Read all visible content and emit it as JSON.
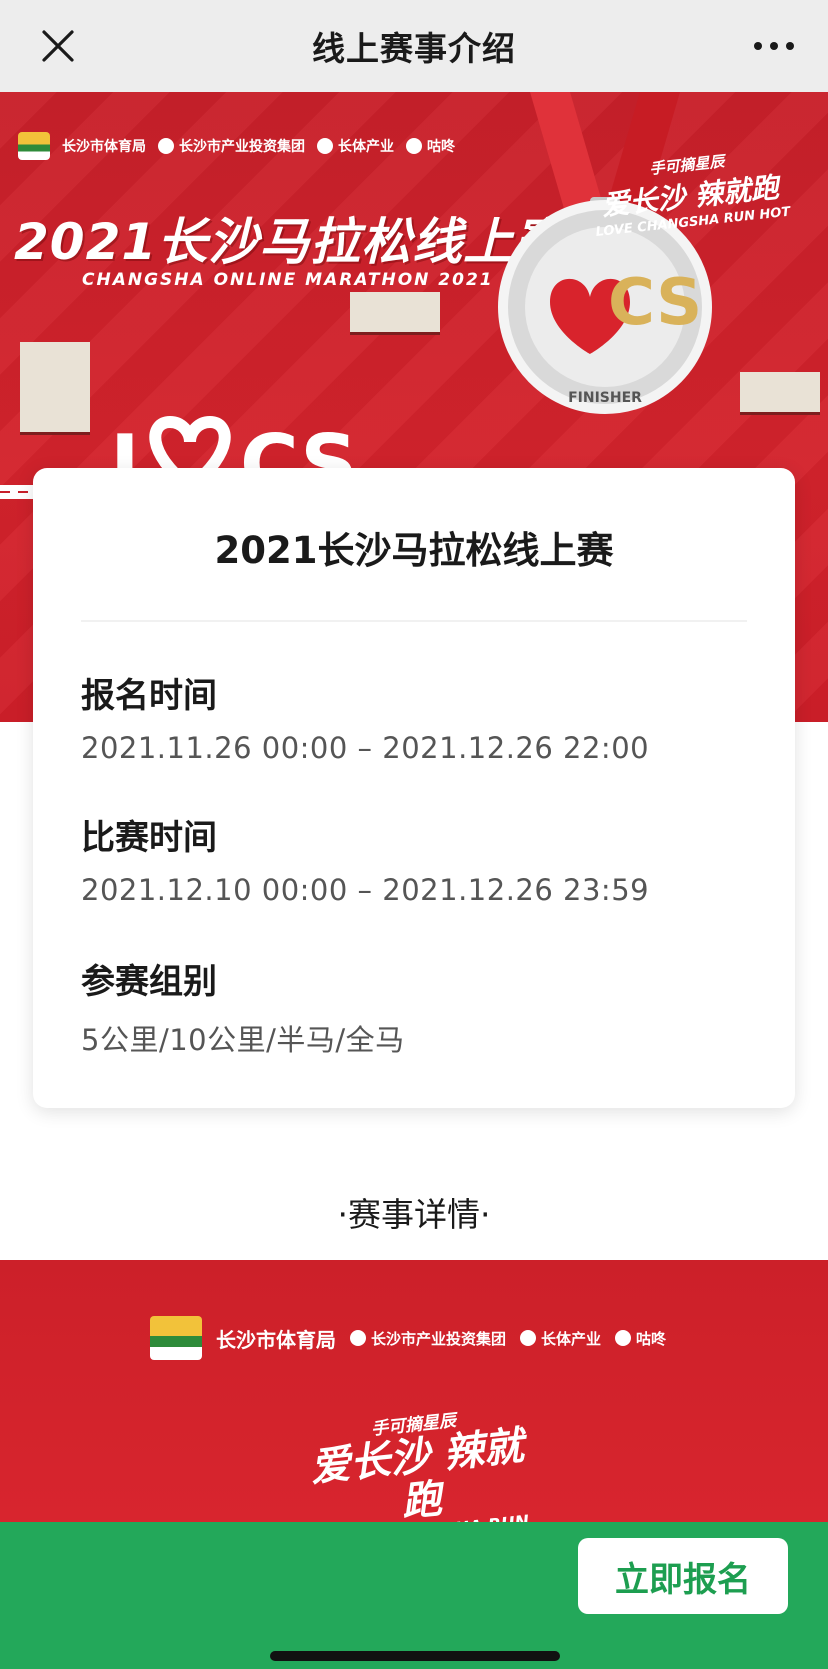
{
  "nav": {
    "title": "线上赛事介绍",
    "close_icon": "close-icon",
    "more_icon": "more-dots-icon"
  },
  "hero": {
    "logos": [
      "长沙市体育局",
      "长沙市产业投资集团",
      "长体产业",
      "咕咚"
    ],
    "title": "2021长沙马拉松线上赛",
    "subtitle": "CHANGSHA ONLINE MARATHON 2021",
    "slogan_line1": "手可摘星辰",
    "slogan_line2": "爱长沙 辣就跑",
    "slogan_line3": "LOVE CHANGSHA RUN HOT",
    "medal_ring_text": "CHANGSHA ONLINE MARATHON 2021",
    "medal_center_text": "CS",
    "medal_bottom_text": "FINISHER",
    "road_text": "I CS"
  },
  "card": {
    "title": "2021长沙马拉松线上赛",
    "sections": [
      {
        "label": "报名时间",
        "value": "2021.11.26 00:00 – 2021.12.26 22:00"
      },
      {
        "label": "比赛时间",
        "value": "2021.12.10 00:00 – 2021.12.26 23:59"
      },
      {
        "label": "参赛组别",
        "value": "5公里/10公里/半马/全马"
      }
    ]
  },
  "details_heading": "·赛事详情·",
  "footer_banner": {
    "logos": [
      "长沙市体育局",
      "长沙市产业投资集团",
      "长体产业",
      "咕咚"
    ],
    "slogan_line1": "手可摘星辰",
    "slogan_line2": "爱长沙 辣就跑",
    "slogan_line3": "LOVE CHANGSHA RUN HOT"
  },
  "action": {
    "register_label": "立即报名"
  },
  "colors": {
    "brand_red": "#d4232c",
    "action_green": "#23a85a",
    "button_text_green": "#1d9e50"
  }
}
